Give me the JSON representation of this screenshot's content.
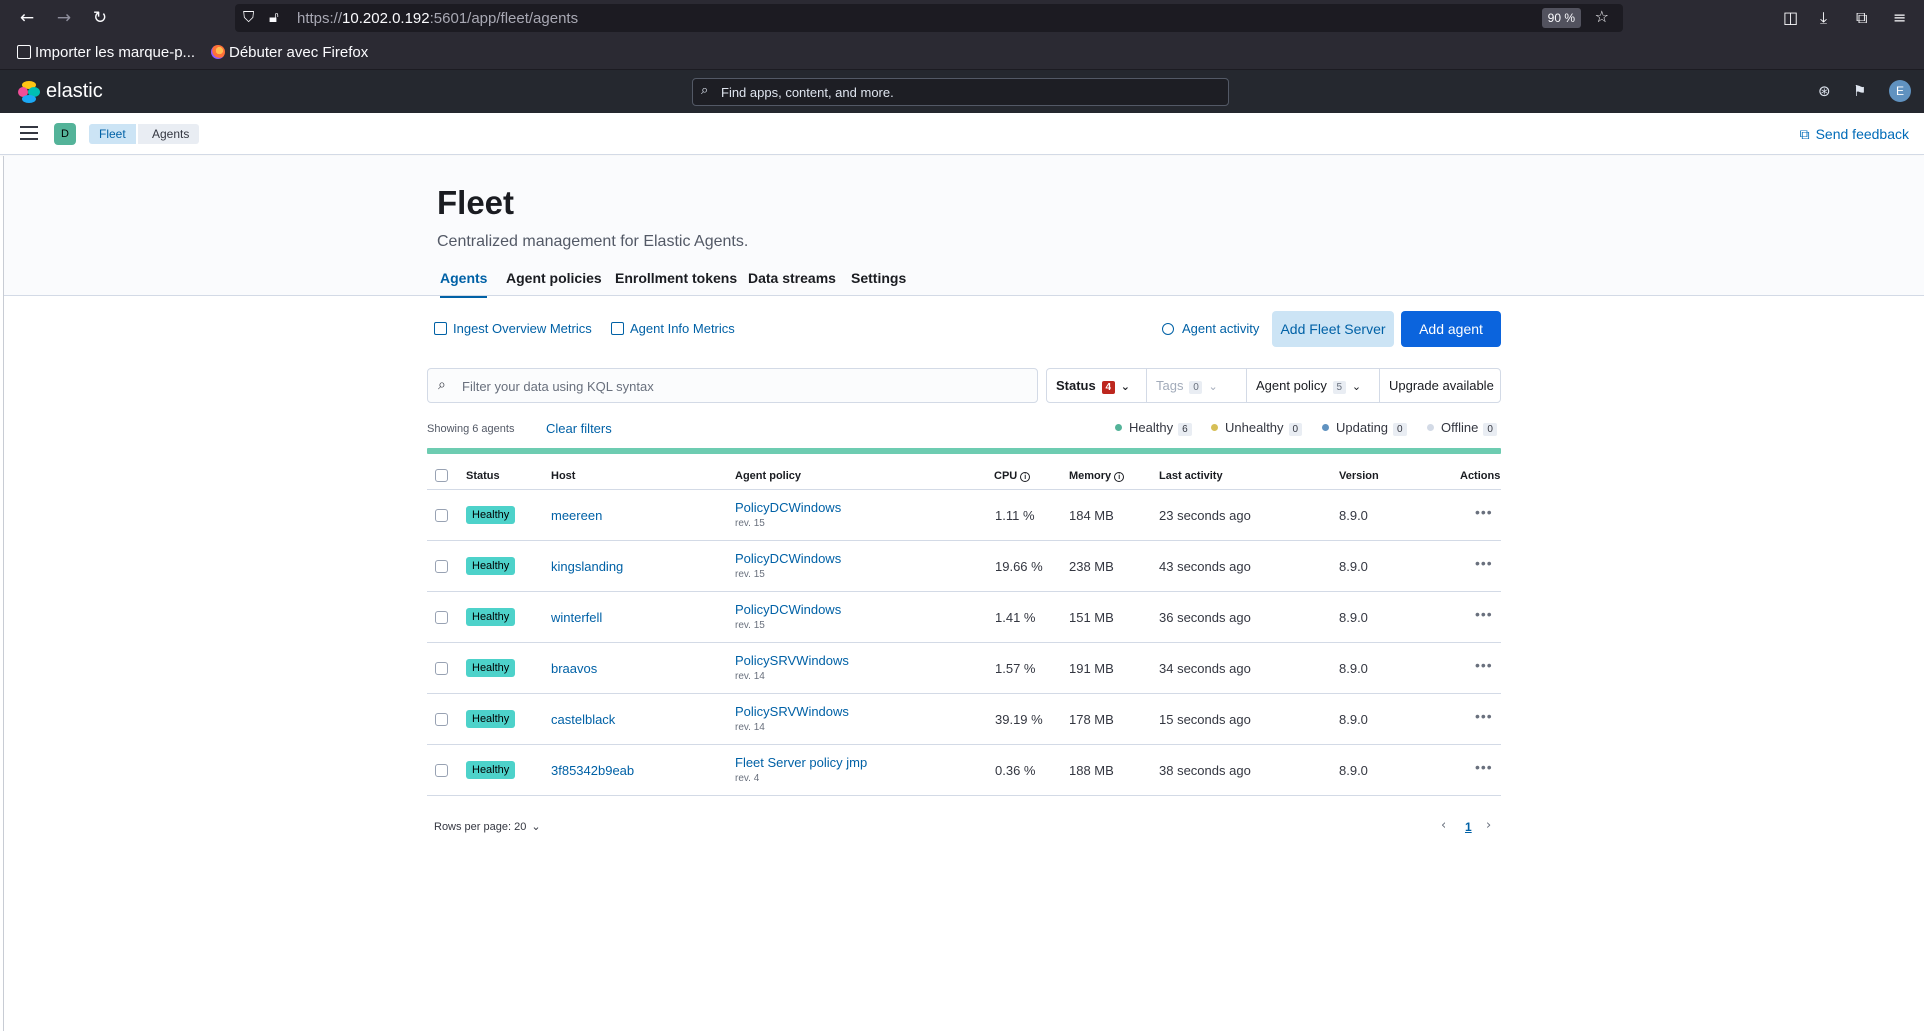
{
  "browser": {
    "url_prefix": "https://",
    "url_host": "10.202.0.192",
    "url_rest": ":5601/app/fleet/agents",
    "zoom": "90 %",
    "bookmarks": [
      {
        "label": "Importer les marque-p..."
      },
      {
        "label": "Débuter avec Firefox"
      }
    ]
  },
  "header": {
    "brand": "elastic",
    "search_placeholder": "Find apps, content, and more.",
    "avatar_initial": "E"
  },
  "subheader": {
    "space_initial": "D",
    "breadcrumbs": [
      "Fleet",
      "Agents"
    ],
    "send_feedback": "Send feedback"
  },
  "page": {
    "title": "Fleet",
    "description": "Centralized management for Elastic Agents.",
    "tabs": [
      "Agents",
      "Agent policies",
      "Enrollment tokens",
      "Data streams",
      "Settings"
    ],
    "active_tab": "Agents"
  },
  "toolbar": {
    "ingest_metrics": "Ingest Overview Metrics",
    "agent_metrics": "Agent Info Metrics",
    "agent_activity": "Agent activity",
    "add_fleet_server": "Add Fleet Server",
    "add_agent": "Add agent"
  },
  "filters": {
    "kql_placeholder": "Filter your data using KQL syntax",
    "status_label": "Status",
    "status_count": "4",
    "tags_label": "Tags",
    "tags_count": "0",
    "policy_label": "Agent policy",
    "policy_count": "5",
    "upgrade_label": "Upgrade available"
  },
  "summary": {
    "showing": "Showing 6 agents",
    "clear_filters": "Clear filters",
    "legend": [
      {
        "label": "Healthy",
        "count": "6",
        "color": "#54b399"
      },
      {
        "label": "Unhealthy",
        "count": "0",
        "color": "#d6bf57"
      },
      {
        "label": "Updating",
        "count": "0",
        "color": "#6092c0"
      },
      {
        "label": "Offline",
        "count": "0",
        "color": "#d3dae6"
      }
    ]
  },
  "table": {
    "columns": {
      "status": "Status",
      "host": "Host",
      "policy": "Agent policy",
      "cpu": "CPU",
      "memory": "Memory",
      "last_activity": "Last activity",
      "version": "Version",
      "actions": "Actions"
    },
    "rows": [
      {
        "status": "Healthy",
        "host": "meereen",
        "policy": "PolicyDCWindows",
        "rev": "rev. 15",
        "cpu": "1.11 %",
        "memory": "184 MB",
        "last_activity": "23 seconds ago",
        "version": "8.9.0"
      },
      {
        "status": "Healthy",
        "host": "kingslanding",
        "policy": "PolicyDCWindows",
        "rev": "rev. 15",
        "cpu": "19.66 %",
        "memory": "238 MB",
        "last_activity": "43 seconds ago",
        "version": "8.9.0"
      },
      {
        "status": "Healthy",
        "host": "winterfell",
        "policy": "PolicyDCWindows",
        "rev": "rev. 15",
        "cpu": "1.41 %",
        "memory": "151 MB",
        "last_activity": "36 seconds ago",
        "version": "8.9.0"
      },
      {
        "status": "Healthy",
        "host": "braavos",
        "policy": "PolicySRVWindows",
        "rev": "rev. 14",
        "cpu": "1.57 %",
        "memory": "191 MB",
        "last_activity": "34 seconds ago",
        "version": "8.9.0"
      },
      {
        "status": "Healthy",
        "host": "castelblack",
        "policy": "PolicySRVWindows",
        "rev": "rev. 14",
        "cpu": "39.19 %",
        "memory": "178 MB",
        "last_activity": "15 seconds ago",
        "version": "8.9.0"
      },
      {
        "status": "Healthy",
        "host": "3f85342b9eab",
        "policy": "Fleet Server policy jmp",
        "rev": "rev. 4",
        "cpu": "0.36 %",
        "memory": "188 MB",
        "last_activity": "38 seconds ago",
        "version": "8.9.0"
      }
    ]
  },
  "footer": {
    "rows_per_page": "Rows per page: 20",
    "current_page": "1"
  }
}
